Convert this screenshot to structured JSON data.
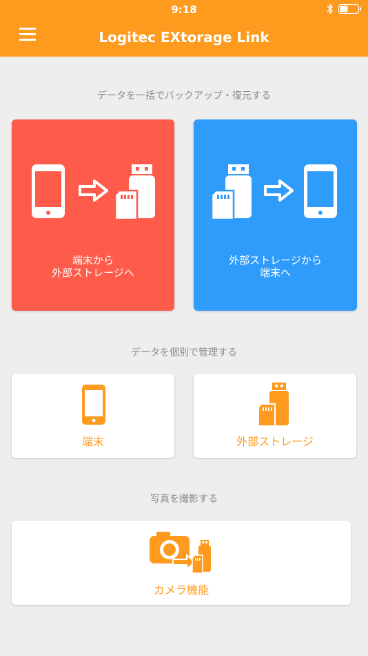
{
  "status_bar": {
    "time": "9:18"
  },
  "header": {
    "title": "Logitec EXtorage Link"
  },
  "backup_section": {
    "label": "データを一括でバックアップ・復元する",
    "to_storage": {
      "line1": "端末から",
      "line2": "外部ストレージへ"
    },
    "to_device": {
      "line1": "外部ストレージから",
      "line2": "端末へ"
    }
  },
  "manage_section": {
    "label": "データを個別で管理する",
    "device_label": "端末",
    "storage_label": "外部ストレージ"
  },
  "camera_section": {
    "label": "写真を撮影する",
    "camera_label": "カメラ機能"
  },
  "colors": {
    "brand_orange": "#fe9a1e",
    "red_card": "#fe5b4a",
    "blue_card": "#2f9cfb",
    "background": "#eeeeee"
  }
}
